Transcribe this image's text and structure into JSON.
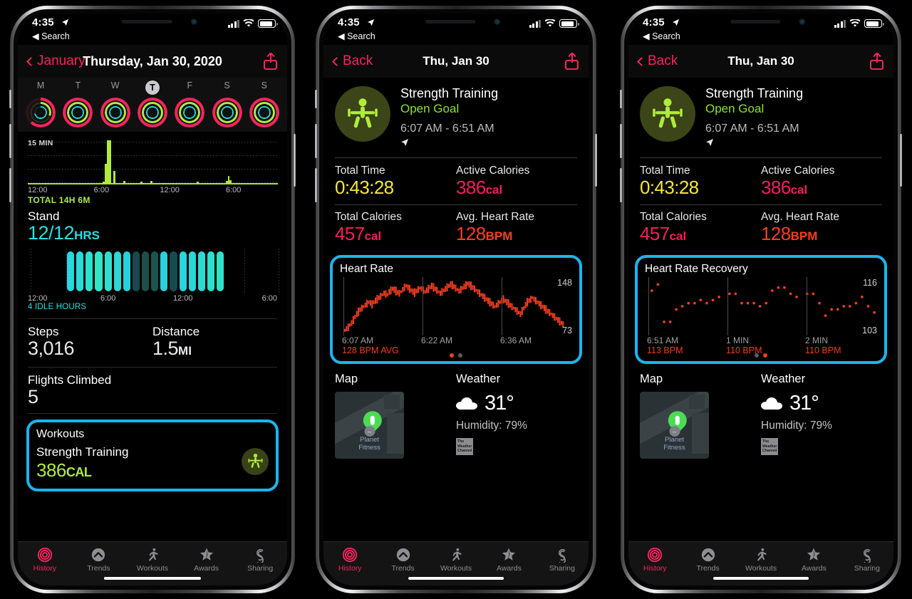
{
  "status_bar": {
    "time": "4:35",
    "back_label": "Search",
    "location_icon": "location-arrow-icon",
    "signal_icon": "cellular-signal-icon",
    "wifi_icon": "wifi-icon",
    "battery_icon": "battery-icon"
  },
  "colors": {
    "highlight": "#18b6f0",
    "accent_pink": "#f5245d",
    "move_ring": "#f5245d",
    "exercise_ring": "#b0ec3c",
    "stand_ring": "#25e0df",
    "yellow": "#f6e832",
    "red": "#fa3c20",
    "green_text": "#8fe320"
  },
  "tab_bar": {
    "items": [
      {
        "label": "History",
        "icon": "rings-icon",
        "active": true
      },
      {
        "label": "Trends",
        "icon": "chevron-up-circle-icon",
        "active": false
      },
      {
        "label": "Workouts",
        "icon": "runner-icon",
        "active": false
      },
      {
        "label": "Awards",
        "icon": "star-badge-icon",
        "active": false
      },
      {
        "label": "Sharing",
        "icon": "s-rings-icon",
        "active": false
      }
    ]
  },
  "phone1": {
    "nav": {
      "back_label": "January",
      "title": "Thursday, Jan 30, 2020",
      "share_icon": "share-icon"
    },
    "week": {
      "days": [
        "M",
        "T",
        "W",
        "T",
        "F",
        "S",
        "S"
      ],
      "selected_index": 3
    },
    "exercise": {
      "y_label": "15 MIN",
      "axis": [
        "12:00",
        "6:00",
        "12:00",
        "6:00"
      ],
      "total": "TOTAL 14H 6M"
    },
    "stand": {
      "title": "Stand",
      "value": "12/12",
      "unit": "HRS",
      "axis": [
        "12:00",
        "6:00",
        "12:00",
        "6:00"
      ],
      "note": "4 IDLE HOURS"
    },
    "steps": {
      "title": "Steps",
      "value": "3,016"
    },
    "distance": {
      "title": "Distance",
      "value": "1.5",
      "unit": "MI"
    },
    "flights": {
      "title": "Flights Climbed",
      "value": "5"
    },
    "workouts_card": {
      "title": "Workouts",
      "name": "Strength Training",
      "value": "386",
      "unit": "CAL",
      "icon": "strength-training-icon"
    }
  },
  "phone2": {
    "nav": {
      "back_label": "Back",
      "title": "Thu, Jan 30",
      "share_icon": "share-icon"
    },
    "workout": {
      "badge_icon": "strength-training-icon",
      "name": "Strength Training",
      "goal": "Open Goal",
      "time_range": "6:07 AM - 6:51 AM",
      "location_icon": "location-arrow-icon"
    },
    "stats": [
      {
        "label": "Total Time",
        "value": "0:43:28",
        "unit": "",
        "color": "yellow"
      },
      {
        "label": "Active Calories",
        "value": "386",
        "unit": "cal",
        "color": "pink"
      },
      {
        "label": "Total Calories",
        "value": "457",
        "unit": "cal",
        "color": "pink"
      },
      {
        "label": "Avg. Heart Rate",
        "value": "128",
        "unit": "BPM",
        "color": "red"
      }
    ],
    "hr_card": {
      "title": "Heart Rate",
      "max": "148",
      "min": "73",
      "ticks": [
        {
          "label": "6:07 AM",
          "value": "128 BPM AVG"
        },
        {
          "label": "6:22 AM",
          "value": ""
        },
        {
          "label": "6:36 AM",
          "value": ""
        }
      ],
      "page_dots": 2,
      "active_dot": 0
    },
    "map": {
      "title": "Map",
      "place": "Planet\nFitness",
      "pin_icon": "map-pin-icon"
    },
    "weather": {
      "title": "Weather",
      "icon": "cloud-icon",
      "temp": "31°",
      "humidity": "Humidity: 79%",
      "provider": "The Weather Channel"
    }
  },
  "phone3": {
    "nav": {
      "back_label": "Back",
      "title": "Thu, Jan 30",
      "share_icon": "share-icon"
    },
    "workout": {
      "badge_icon": "strength-training-icon",
      "name": "Strength Training",
      "goal": "Open Goal",
      "time_range": "6:07 AM - 6:51 AM",
      "location_icon": "location-arrow-icon"
    },
    "stats": [
      {
        "label": "Total Time",
        "value": "0:43:28",
        "unit": "",
        "color": "yellow"
      },
      {
        "label": "Active Calories",
        "value": "386",
        "unit": "cal",
        "color": "pink"
      },
      {
        "label": "Total Calories",
        "value": "457",
        "unit": "cal",
        "color": "pink"
      },
      {
        "label": "Avg. Heart Rate",
        "value": "128",
        "unit": "BPM",
        "color": "red"
      }
    ],
    "hrr_card": {
      "title": "Heart Rate Recovery",
      "max": "116",
      "min": "103",
      "ticks": [
        {
          "label": "6:51 AM",
          "value": "113 BPM"
        },
        {
          "label": "1 MIN",
          "value": "110 BPM"
        },
        {
          "label": "2 MIN",
          "value": "110 BPM"
        }
      ],
      "page_dots": 2,
      "active_dot": 1
    },
    "map": {
      "title": "Map",
      "place": "Planet\nFitness",
      "pin_icon": "map-pin-icon"
    },
    "weather": {
      "title": "Weather",
      "icon": "cloud-icon",
      "temp": "31°",
      "humidity": "Humidity: 79%",
      "provider": "The Weather Channel"
    }
  },
  "chart_data": [
    {
      "type": "bar",
      "title": "Exercise minutes",
      "ylabel": "15 MIN",
      "xlabel": "",
      "categories": [
        "12:00",
        "6:00",
        "12:00",
        "6:00"
      ],
      "ylim": [
        0,
        15
      ],
      "annotation": "TOTAL 14H 6M",
      "values": [
        0.4,
        0.4,
        0.4,
        0.4,
        0.4,
        0.4,
        0.4,
        0.4,
        0.4,
        0.4,
        0.4,
        0.4,
        0.4,
        0.4,
        0.4,
        0.4,
        0.4,
        0.4,
        0.4,
        0.4,
        0.4,
        0.4,
        0.4,
        0.4,
        0.4,
        0.4,
        0.4,
        0.4,
        0.4,
        0.4,
        0.4,
        0.4,
        0.4,
        0.4,
        0.4,
        0.4,
        1.0,
        7.0,
        15.0,
        15.0,
        0.4,
        4.5,
        0.4,
        0.4,
        0.4,
        0.4,
        1.2,
        0.4,
        0.4,
        0.4,
        0.4,
        0.4,
        0.4,
        0.4,
        1.0,
        0.4,
        0.4,
        0.4,
        0.4,
        1.2,
        0.4,
        0.4,
        0.4,
        0.4,
        0.4,
        0.4,
        0.4,
        0.4,
        0.4,
        0.4,
        0.4,
        0.4,
        0.4,
        0.4,
        0.4,
        0.4,
        0.4,
        0.4,
        0.4,
        0.4,
        0.4,
        1.0,
        0.4,
        0.4,
        0.4,
        0.4,
        0.4,
        0.4,
        0.4,
        0.4,
        0.4,
        0.4,
        0.4,
        0.4,
        0.4,
        1.2,
        3.0,
        1.4,
        0.4,
        0.4,
        0.4,
        0.4,
        0.4,
        0.4,
        0.4,
        0.4,
        0.4,
        0.4,
        0.4,
        0.4,
        0.4,
        0.4,
        0.4,
        0.4,
        0.4,
        0.4,
        0.4,
        0.4,
        0.4,
        0.4
      ]
    },
    {
      "type": "bar",
      "title": "Stand hours",
      "categories": [
        "12:00",
        "6:00",
        "12:00",
        "6:00"
      ],
      "ylabel": "",
      "values": [
        1,
        1,
        1,
        1,
        1,
        1,
        1,
        1,
        1,
        1,
        1,
        1,
        1,
        1,
        1,
        1,
        1
      ],
      "bar_colors": [
        "#2ad6e0",
        "#28dcd8",
        "#2ae2d0",
        "#30e6c6",
        "#2ee0cc",
        "#2ad8d4",
        "#26d2d8",
        "#174a4c",
        "#1b4f4a",
        "#1d5450",
        "#2ad0dc",
        "#174a4c",
        "#2ad4dc",
        "#27d8d6",
        "#2adcd2",
        "#2ce0cc",
        "#2ee2c8"
      ],
      "note": "4 IDLE HOURS"
    },
    {
      "type": "scatter",
      "title": "Heart Rate",
      "ylabel": "BPM",
      "ylim": [
        73,
        148
      ],
      "x_ticks": [
        "6:07 AM",
        "6:22 AM",
        "6:36 AM"
      ],
      "annotation": "128 BPM AVG",
      "series": [
        {
          "name": "heart rate",
          "values": [
            78,
            80,
            82,
            85,
            88,
            92,
            96,
            100,
            103,
            106,
            108,
            110,
            112,
            114,
            116,
            115,
            113,
            116,
            118,
            120,
            122,
            124,
            126,
            128,
            127,
            126,
            130,
            132,
            134,
            133,
            131,
            129,
            128,
            130,
            133,
            136,
            138,
            136,
            134,
            132,
            130,
            129,
            131,
            133,
            135,
            134,
            132,
            130,
            132,
            134,
            136,
            138,
            136,
            134,
            132,
            130,
            128,
            130,
            132,
            134,
            136,
            138,
            140,
            139,
            137,
            135,
            133,
            131,
            133,
            135,
            137,
            139,
            141,
            140,
            138,
            136,
            134,
            132,
            130,
            128,
            126,
            124,
            122,
            120,
            118,
            116,
            114,
            112,
            110,
            112,
            114,
            116,
            118,
            120,
            118,
            116,
            114,
            112,
            110,
            108,
            106,
            104,
            102,
            100,
            104,
            108,
            112,
            116,
            118,
            120,
            122,
            120,
            118,
            116,
            114,
            112,
            110,
            108,
            106,
            104,
            102,
            100,
            98,
            96,
            94,
            92,
            90,
            88,
            86
          ]
        }
      ]
    },
    {
      "type": "scatter",
      "title": "Heart Rate Recovery",
      "ylim": [
        103,
        116
      ],
      "x_ticks": [
        "6:51 AM",
        "1 MIN",
        "2 MIN"
      ],
      "tick_values": [
        "113 BPM",
        "110 BPM",
        "110 BPM"
      ],
      "series": [
        {
          "name": "recovery heart rate",
          "values": [
            114,
            116,
            104,
            104,
            108,
            109,
            110,
            110,
            111,
            110,
            111,
            112,
            113,
            113,
            110,
            110,
            110,
            109,
            110,
            114,
            115,
            115,
            113,
            112,
            113,
            113,
            110,
            106,
            108,
            108,
            109,
            109,
            110,
            112,
            109,
            107
          ]
        }
      ]
    }
  ]
}
